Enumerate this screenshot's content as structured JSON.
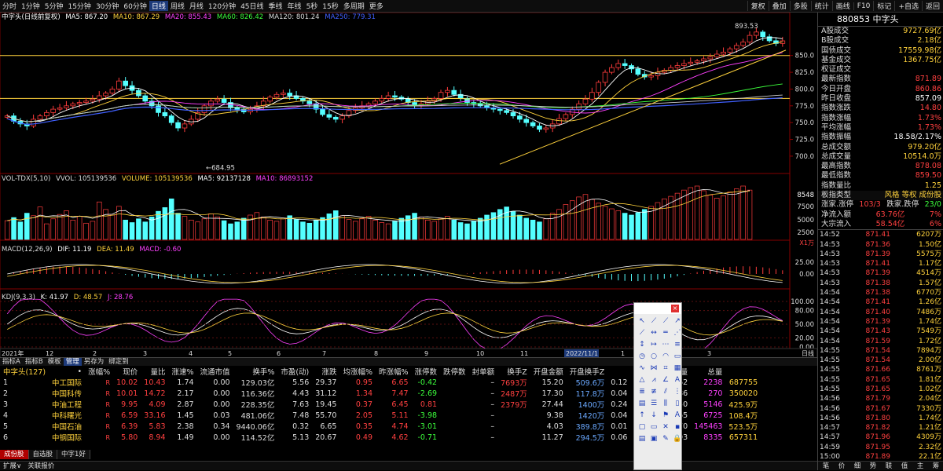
{
  "toolbar": {
    "periods": [
      "分时",
      "1分钟",
      "5分钟",
      "15分钟",
      "30分钟",
      "60分钟",
      "日线",
      "周线",
      "月线",
      "120分钟",
      "45日线",
      "季线",
      "年线",
      "5秒",
      "15秒",
      "多周期",
      "更多"
    ],
    "active_period": "日线",
    "right_buttons": [
      "复权",
      "叠加",
      "多股",
      "统计",
      "画线",
      "F10",
      "标记",
      "+自选",
      "返回"
    ]
  },
  "main_legend": {
    "name": "中字头(日线前复权)",
    "ma5": "MA5: 867.20",
    "ma10": "MA10: 867.29",
    "ma20": "MA20: 855.43",
    "ma60": "MA60: 826.42",
    "ma120": "MA120: 801.24",
    "ma250": "MA250: 779.31"
  },
  "price_axis": [
    "850.0",
    "825.0",
    "800.0",
    "775.0",
    "750.0",
    "725.0",
    "700.0"
  ],
  "price_annotations": {
    "high": "893.53",
    "low": "684.95"
  },
  "vol_legend": {
    "name": "VOL-TDX(5,10)",
    "vvol": "VVOL: 105139536",
    "volume": "VOLUME: 105139536",
    "ma5": "MA5: 92137128",
    "ma10": "MA10: 86893152"
  },
  "vol_axis": [
    "8548",
    "7500",
    "5000",
    "2500"
  ],
  "vol_unit": "X1万",
  "macd_legend": {
    "name": "MACD(12,26,9)",
    "dif": "DIF: 11.19",
    "dea": "DEA: 11.49",
    "macd": "MACD: -0.60"
  },
  "macd_axis": [
    "25.00",
    "0.00"
  ],
  "kdj_legend": {
    "name": "KDJ(9,3,3)",
    "k": "K: 41.97",
    "d": "D: 48.57",
    "j": "J: 28.76"
  },
  "kdj_axis": [
    "100.00",
    "80.00",
    "50.00",
    "20.00",
    "0.00"
  ],
  "date_axis": [
    "2021年",
    "12",
    "2",
    "3",
    "4",
    "5",
    "6",
    "7",
    "8",
    "9",
    "10",
    "11",
    "2022/11/1",
    "1",
    "2",
    "3"
  ],
  "date_axis_right": "日线",
  "right_panel": {
    "code": "880853",
    "name": "中字头",
    "stats": [
      {
        "k": "A股成交",
        "v": "9727.69亿",
        "c": "yellow"
      },
      {
        "k": "B股成交",
        "v": "2.18亿",
        "c": "yellow"
      },
      {
        "k": "国债成交",
        "v": "17559.98亿",
        "c": "yellow"
      },
      {
        "k": "基金成交",
        "v": "1367.75亿",
        "c": "yellow"
      },
      {
        "k": "权证成交",
        "v": "",
        "c": "yellow"
      },
      {
        "k": "最新指数",
        "v": "871.89",
        "c": "red"
      },
      {
        "k": "今日开盘",
        "v": "860.86",
        "c": "red"
      },
      {
        "k": "昨日收盘",
        "v": "857.09",
        "c": "white"
      },
      {
        "k": "指数涨跌",
        "v": "14.80",
        "c": "red"
      },
      {
        "k": "指数涨幅",
        "v": "1.73%",
        "c": "red"
      },
      {
        "k": "平均涨幅",
        "v": "1.73%",
        "c": "red"
      },
      {
        "k": "指数振幅",
        "v": "18.58/2.17%",
        "c": "white"
      },
      {
        "k": "总成交额",
        "v": "979.20亿",
        "c": "yellow"
      },
      {
        "k": "总成交量",
        "v": "10514.0万",
        "c": "yellow"
      },
      {
        "k": "最高指数",
        "v": "878.08",
        "c": "red"
      },
      {
        "k": "最低指数",
        "v": "859.50",
        "c": "red"
      },
      {
        "k": "指数量比",
        "v": "1.25",
        "c": "yellow"
      }
    ],
    "board_type": {
      "k": "板指类型",
      "v": "风格 等权 成份股"
    },
    "updown": {
      "k": "涨家.涨停",
      "v": "103/3",
      "k2": "跌家.跌停",
      "v2": "23/0"
    },
    "netflow": [
      {
        "k": "净流入额",
        "v": "63.76亿",
        "p": "7%"
      },
      {
        "k": "大宗流入",
        "v": "58.54亿",
        "p": "6%"
      }
    ],
    "ticks": [
      {
        "t": "14:52",
        "p": "871.41",
        "q": "6207万"
      },
      {
        "t": "14:53",
        "p": "871.36",
        "q": "1.50亿"
      },
      {
        "t": "14:53",
        "p": "871.39",
        "q": "5575万"
      },
      {
        "t": "14:53",
        "p": "871.41",
        "q": "1.17亿"
      },
      {
        "t": "14:53",
        "p": "871.39",
        "q": "4514万"
      },
      {
        "t": "14:53",
        "p": "871.38",
        "q": "1.57亿"
      },
      {
        "t": "14:54",
        "p": "871.38",
        "q": "6770万"
      },
      {
        "t": "14:54",
        "p": "871.41",
        "q": "1.26亿"
      },
      {
        "t": "14:54",
        "p": "871.40",
        "q": "7486万"
      },
      {
        "t": "14:54",
        "p": "871.39",
        "q": "1.74亿"
      },
      {
        "t": "14:54",
        "p": "871.43",
        "q": "7549万"
      },
      {
        "t": "14:54",
        "p": "871.59",
        "q": "1.72亿"
      },
      {
        "t": "14:55",
        "p": "871.54",
        "q": "7894万"
      },
      {
        "t": "14:55",
        "p": "871.54",
        "q": "2.00亿"
      },
      {
        "t": "14:55",
        "p": "871.66",
        "q": "8761万"
      },
      {
        "t": "14:55",
        "p": "871.65",
        "q": "1.81亿"
      },
      {
        "t": "14:55",
        "p": "871.65",
        "q": "1.02亿"
      },
      {
        "t": "14:56",
        "p": "871.79",
        "q": "2.04亿"
      },
      {
        "t": "14:56",
        "p": "871.67",
        "q": "7330万"
      },
      {
        "t": "14:56",
        "p": "871.80",
        "q": "1.74亿"
      },
      {
        "t": "14:57",
        "p": "871.82",
        "q": "1.21亿"
      },
      {
        "t": "14:57",
        "p": "871.96",
        "q": "4309万"
      },
      {
        "t": "14:59",
        "p": "871.95",
        "q": "2.32亿"
      },
      {
        "t": "15:00",
        "p": "871.89",
        "q": "22.1亿"
      }
    ],
    "bottom_tabs": [
      "笔",
      "价",
      "细",
      "势",
      "联",
      "值",
      "主",
      "筹"
    ]
  },
  "tablinks": [
    "指标A",
    "指标B",
    "模板",
    "管理",
    "另存为",
    "绑定到"
  ],
  "table": {
    "title": "中字头(127)",
    "headers": [
      "•",
      "涨幅%",
      "现价",
      "量比",
      "涨速%",
      "流通市值",
      "换手%",
      "市盈(动)",
      "涨跌",
      "均涨幅%",
      "昨涨幅%",
      "涨停数",
      "跌停数",
      "封单额",
      "换手Z",
      "开盘金额",
      "开盘换手Z",
      "",
      "",
      "活跃度",
      "现量",
      "总量"
    ],
    "rows": [
      [
        "1",
        "中工国际",
        "R",
        "10.02",
        "10.43",
        "1.74",
        "0.00",
        "129.03亿",
        "5.56",
        "29.37",
        "0.95",
        "6.65",
        "-0.42",
        "",
        "–",
        "7693万",
        "15.20",
        "509.6万",
        "0.12",
        "",
        "",
        "3062",
        "2238",
        "687755"
      ],
      [
        "2",
        "中国科传",
        "R",
        "10.01",
        "14.72",
        "2.17",
        "0.00",
        "116.36亿",
        "4.43",
        "31.12",
        "1.34",
        "7.47",
        "-2.69",
        "",
        "–",
        "2487万",
        "17.30",
        "117.8万",
        "0.04",
        "",
        "",
        "3686",
        "270",
        "350020"
      ],
      [
        "3",
        "中油工程",
        "R",
        "9.95",
        "4.09",
        "2.87",
        "0.00",
        "228.35亿",
        "7.63",
        "19.45",
        "0.37",
        "6.45",
        "0.81",
        "",
        "–",
        "2379万",
        "27.44",
        "1400万",
        "0.24",
        "",
        "",
        "4450",
        "5146",
        "425.9万"
      ],
      [
        "4",
        "中科曙光",
        "R",
        "6.59",
        "33.16",
        "1.45",
        "0.03",
        "481.06亿",
        "7.48",
        "55.70",
        "2.05",
        "5.11",
        "-3.98",
        "",
        "–",
        "",
        "9.38",
        "1420万",
        "0.04",
        "",
        "",
        "4665",
        "6725",
        "108.4万"
      ],
      [
        "5",
        "中国石油",
        "R",
        "6.39",
        "5.83",
        "2.38",
        "0.34",
        "9440.06亿",
        "0.32",
        "6.65",
        "0.35",
        "4.74",
        "-3.01",
        "",
        "–",
        "",
        "4.03",
        "389.8万",
        "0.01",
        "",
        "",
        "4670",
        "145463",
        "523.5万"
      ],
      [
        "6",
        "中钢国际",
        "R",
        "5.80",
        "8.94",
        "1.49",
        "0.00",
        "114.52亿",
        "5.13",
        "20.67",
        "0.49",
        "4.62",
        "-0.71",
        "",
        "–",
        "",
        "11.27",
        "294.5万",
        "0.06",
        "",
        "",
        "4303",
        "8335",
        "657311"
      ]
    ]
  },
  "bottom_tabs": [
    "成份股",
    "自选股",
    "中字1好"
  ],
  "statusbar": [
    "扩展∨",
    "关联报价"
  ],
  "draw_panel_icons": [
    "pointer-tool",
    "line-tool",
    "ray-tool",
    "arrow-line-tool",
    "segment-tool",
    "hline-tool",
    "parallel-tool",
    "channel-tool",
    "vline-tool",
    "price-line-tool",
    "dash-line-tool",
    "fib-line-tool",
    "cycle-tool",
    "circle-tool",
    "arc-tool",
    "rect-tool",
    "wave-tool",
    "fan-tool",
    "gann-tool",
    "grid-tool",
    "triangle-tool",
    "tri-line-tool",
    "angle-tool",
    "text-tool",
    "fib-ret-tool",
    "fib-ext-tool",
    "speed-tool",
    "gann-fan-tool",
    "ruler-tool",
    "multi-line-tool",
    "cycle-line-tool",
    "box-tool",
    "up-arrow-tool",
    "down-arrow-tool",
    "flag-tool",
    "label-tool",
    "text-box-tool",
    "price-tag-tool",
    "cross-tool",
    "eraser-tool",
    "note-tool",
    "copy-tool",
    "brush-tool",
    "lock-tool"
  ],
  "chart_data": {
    "type": "candlestick",
    "title": "中字头(日线前复权)",
    "ylim": [
      680,
      900
    ],
    "annotations": [
      {
        "label": "893.53"
      },
      {
        "label": "684.95"
      }
    ],
    "x_tick_labels": [
      "2021年",
      "12",
      "2",
      "3",
      "4",
      "5",
      "6",
      "7",
      "8",
      "9",
      "10",
      "11",
      "2022/11/1",
      "1",
      "2",
      "3"
    ],
    "close_series_approx": [
      760,
      752,
      748,
      745,
      755,
      760,
      765,
      770,
      772,
      775,
      778,
      780,
      782,
      785,
      790,
      794,
      800,
      812,
      805,
      798,
      790,
      782,
      775,
      765,
      760,
      750,
      742,
      748,
      755,
      765,
      775,
      782,
      785,
      780,
      772,
      770,
      766,
      770,
      775,
      782,
      788,
      792,
      794,
      790,
      786,
      782,
      778,
      770,
      762,
      758,
      755,
      760,
      768,
      772,
      775,
      778,
      782,
      786,
      790,
      788,
      785,
      780,
      776,
      778,
      782,
      786,
      795,
      798,
      792,
      786,
      780,
      778,
      775,
      772,
      770,
      768,
      765,
      760,
      755,
      750,
      745,
      740,
      742,
      748,
      756,
      762,
      770,
      778,
      785,
      795,
      810,
      825,
      832,
      838,
      835,
      830,
      822,
      818,
      820,
      825,
      828,
      832,
      835,
      838,
      840,
      842,
      845,
      848,
      852,
      855,
      860,
      865,
      870,
      880,
      885,
      878,
      872,
      868,
      871.89
    ],
    "volume_series_approx": [
      3000,
      3500,
      2800,
      4200,
      3800,
      5200,
      2500,
      3300,
      4000,
      4600,
      3100,
      3700,
      2600,
      2900,
      6000,
      4800,
      3900,
      5300,
      3100,
      2700,
      3300,
      2800,
      3600,
      4500,
      5100,
      6500,
      4200,
      3700,
      3100,
      2800,
      3300,
      4100,
      3600,
      3000,
      2500,
      2800,
      3400,
      3900,
      4300,
      3600,
      3100,
      2900,
      3300,
      3800,
      3200,
      2800,
      2600,
      3100,
      3500,
      4100,
      4600,
      3800,
      3200,
      2900,
      3300,
      3700,
      3100,
      2700,
      2500,
      2900,
      3400,
      3800,
      4200,
      3600,
      3100,
      2900,
      3300,
      3700,
      3100,
      2700,
      2500,
      2900,
      3400,
      3900,
      4300,
      4800,
      5200,
      4500,
      3900,
      3400,
      3100,
      2800,
      3300,
      4200,
      4800,
      5600,
      6200,
      6800,
      7200,
      6400,
      5800,
      5300,
      4900,
      4600,
      4200,
      3900,
      4300,
      4800,
      5300,
      5900,
      6500,
      6900,
      7400,
      7900,
      8300,
      8548,
      7800,
      7100,
      6600,
      7000,
      7600,
      8100,
      8548,
      7900
    ]
  }
}
